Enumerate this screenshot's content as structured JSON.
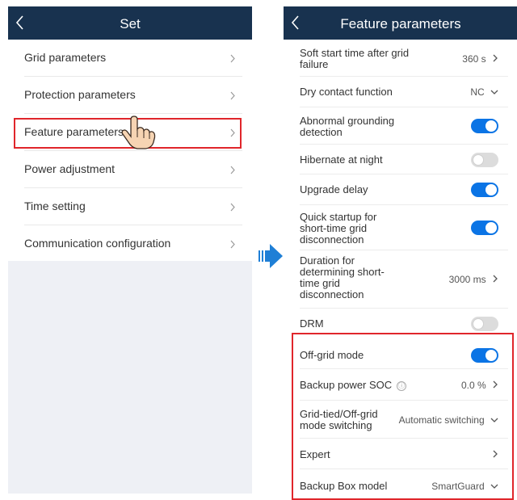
{
  "left": {
    "title": "Set",
    "items": [
      {
        "label": "Grid parameters"
      },
      {
        "label": "Protection parameters"
      },
      {
        "label": "Feature parameters"
      },
      {
        "label": "Power adjustment"
      },
      {
        "label": "Time setting"
      },
      {
        "label": "Communication configuration"
      }
    ]
  },
  "right": {
    "title": "Feature parameters",
    "rows": [
      {
        "label": "Soft start time after grid failure",
        "value": "360 s"
      },
      {
        "label": "Dry contact function",
        "value": "NC"
      },
      {
        "label": "Abnormal grounding detection",
        "toggle": "on"
      },
      {
        "label": "Hibernate at night",
        "toggle": "off"
      },
      {
        "label": "Upgrade delay",
        "toggle": "on"
      },
      {
        "label": "Quick startup for short-time grid disconnection",
        "toggle": "on"
      },
      {
        "label": "Duration for determining short-time grid disconnection",
        "value": "3000 ms"
      },
      {
        "label": "DRM",
        "toggle": "off"
      },
      {
        "label": "Off-grid mode",
        "toggle": "on"
      },
      {
        "label": "Backup power SOC",
        "info_icon": "ⓘ",
        "value": "0.0 %"
      },
      {
        "label": "Grid-tied/Off-grid mode switching",
        "value": "Automatic switching"
      },
      {
        "label": "Expert"
      },
      {
        "label": "Backup Box model",
        "value": "SmartGuard"
      }
    ]
  },
  "colors": {
    "header": "#18324f",
    "toggle_on": "#0b74e5",
    "highlight": "#e0262b",
    "arrow": "#1f7fd6"
  }
}
